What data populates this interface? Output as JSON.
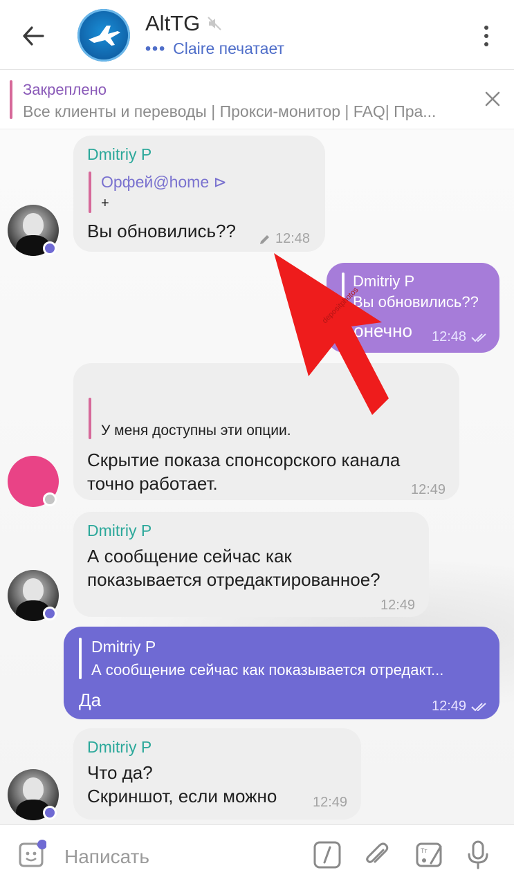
{
  "header": {
    "title": "AltTG",
    "status": "Claire печатает",
    "icons": {
      "back": "arrow-left-icon",
      "muted": "muted-icon",
      "menu": "more-vertical-icon"
    }
  },
  "pinned": {
    "title": "Закреплено",
    "text": "Все клиенты и переводы | Прокси-монитор | FAQ| Пра..."
  },
  "messages": [
    {
      "sender": "Dmitriy P",
      "reply_author": "Орфей@home ⊳",
      "reply_text": "+",
      "text": "Вы обновились??",
      "time": "12:48",
      "edited": true,
      "direction": "incoming"
    },
    {
      "sender": "Dmitriy P",
      "reply_text": "Вы обновились??",
      "text": "Конечно",
      "time": "12:48",
      "direction": "outgoing"
    },
    {
      "reply_text": "У меня доступны эти опции.",
      "text_line1": "Скрытие показа спонсорского канала",
      "text_line2": "точно работает.",
      "time": "12:49",
      "direction": "incoming"
    },
    {
      "sender": "Dmitriy P",
      "text_line1": "А сообщение сейчас как",
      "text_line2": "показывается отредактированное?",
      "time": "12:49",
      "direction": "incoming"
    },
    {
      "sender": "Dmitriy P",
      "reply_text": "А сообщение сейчас как показывается отредакт...",
      "text": "Да",
      "time": "12:49",
      "direction": "outgoing"
    },
    {
      "sender": "Dmitriy P",
      "text_line1": "Что да?",
      "text_line2": "Скриншот, если можно",
      "time": "12:49",
      "direction": "incoming"
    }
  ],
  "overlay": {
    "watermark": "depositphotos"
  },
  "input": {
    "placeholder": "Написать",
    "icons": [
      "sticker-icon",
      "bot-command-icon",
      "attach-icon",
      "paint-icon",
      "microphone-icon"
    ]
  },
  "colors": {
    "accent": "#6f6ad3",
    "outgoing_light": "#a67cd9",
    "sender": "#2ba89a",
    "pinned_bar": "#d6699a",
    "arrow": "#ee1c1c"
  }
}
